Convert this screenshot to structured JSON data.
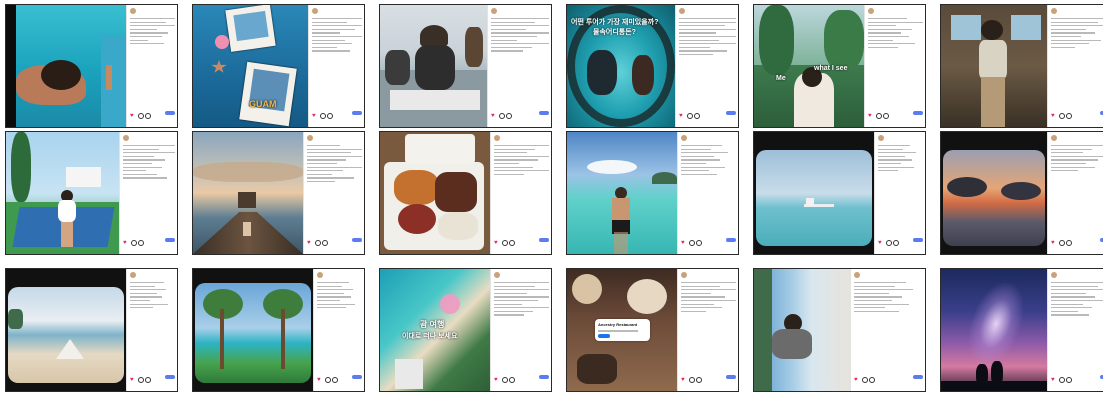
{
  "tiles": [
    {
      "user": "",
      "caption_lines": [
        "",
        "",
        ""
      ],
      "likes": "",
      "overlay_text": ""
    },
    {
      "user": "",
      "caption_lines": [
        "",
        "",
        ""
      ],
      "likes": "",
      "overlay_text": "GUAM"
    },
    {
      "user": "",
      "caption_lines": [
        "",
        "",
        ""
      ],
      "likes": "",
      "overlay_text": ""
    },
    {
      "user": "",
      "caption_lines": [
        "",
        "",
        ""
      ],
      "likes": "",
      "overlay_text_line1": "어떤 투어가 가장 재미있을까?",
      "overlay_text_line2": "물속어디통돈?"
    },
    {
      "user": "",
      "caption_lines": [
        "",
        "",
        ""
      ],
      "likes": "",
      "overlay_text_me": "Me",
      "overlay_text_see": "what I see"
    },
    {
      "user": "",
      "caption_lines": [
        "",
        "",
        ""
      ],
      "likes": "",
      "overlay_text": ""
    },
    {
      "user": "",
      "caption_lines": [
        "",
        "",
        ""
      ],
      "likes": "",
      "overlay_text": ""
    },
    {
      "user": "",
      "caption_lines": [
        "",
        "",
        ""
      ],
      "likes": "",
      "overlay_text": ""
    },
    {
      "user": "",
      "caption_lines": [
        "",
        "",
        ""
      ],
      "likes": "",
      "overlay_text": ""
    },
    {
      "user": "",
      "caption_lines": [
        "",
        "",
        ""
      ],
      "likes": "",
      "overlay_text": ""
    },
    {
      "user": "",
      "caption_lines": [
        "",
        "",
        ""
      ],
      "likes": "",
      "overlay_text": ""
    },
    {
      "user": "",
      "caption_lines": [
        "",
        "",
        ""
      ],
      "likes": "",
      "overlay_text": ""
    },
    {
      "user": "",
      "caption_lines": [
        "",
        "",
        ""
      ],
      "likes": "",
      "overlay_text": ""
    },
    {
      "user": "",
      "caption_lines": [
        "",
        "",
        ""
      ],
      "likes": "",
      "overlay_text": ""
    },
    {
      "user": "",
      "caption_lines": [
        "",
        "",
        ""
      ],
      "likes": "",
      "overlay_text_line1": "괌 여행",
      "overlay_text_line2": "이대로 떠나 보세요"
    },
    {
      "user": "",
      "caption_lines": [
        "",
        "",
        ""
      ],
      "likes": "",
      "overlay_text": "Ancestry Restaurant"
    },
    {
      "user": "",
      "caption_lines": [
        "",
        "",
        ""
      ],
      "likes": "",
      "overlay_text": ""
    },
    {
      "user": "",
      "caption_lines": [
        "",
        "",
        ""
      ],
      "likes": "",
      "overlay_text": ""
    }
  ],
  "colors": {
    "heart": "#e0245e",
    "post_button": "#5b7cf0",
    "tile_border": "#2a2a2a"
  }
}
